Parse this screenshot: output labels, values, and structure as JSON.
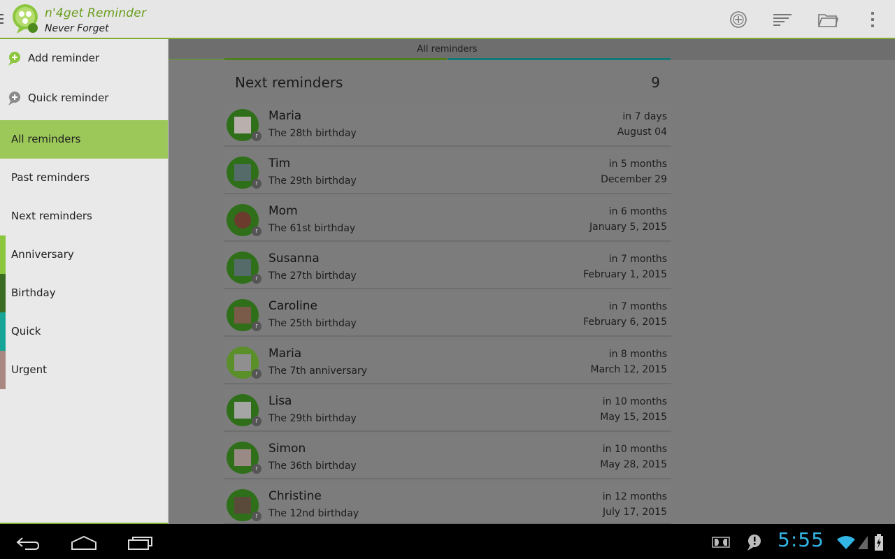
{
  "app": {
    "title": "n'4get Reminder",
    "subtitle": "Never Forget",
    "accent": "#7fae2e"
  },
  "actions": {
    "add_icon": "circle-plus-icon",
    "sort_icon": "sort-lines-icon",
    "folder_icon": "folder-icon",
    "overflow_icon": "overflow-dots-icon"
  },
  "drawer": {
    "actions": [
      {
        "label": "Add reminder",
        "icon": "add-bubble-icon"
      },
      {
        "label": "Quick reminder",
        "icon": "quick-bubble-icon"
      }
    ],
    "filters": [
      {
        "label": "All reminders",
        "selected": true
      },
      {
        "label": "Past reminders",
        "selected": false
      },
      {
        "label": "Next reminders",
        "selected": false
      }
    ],
    "categories": [
      {
        "label": "Anniversary",
        "color": "#8cc63f"
      },
      {
        "label": "Birthday",
        "color": "#3a6d22"
      },
      {
        "label": "Quick",
        "color": "#16a597"
      },
      {
        "label": "Urgent",
        "color": "#a88880"
      }
    ]
  },
  "tabs": {
    "active": "All reminders"
  },
  "list": {
    "title": "Next reminders",
    "count": "9",
    "items": [
      {
        "name": "Maria",
        "occasion": "The 28th birthday",
        "when": "in 7 days",
        "date": "August 04",
        "badge": "r"
      },
      {
        "name": "Tim",
        "occasion": "The 29th birthday",
        "when": "in 5 months",
        "date": "December 29",
        "badge": "r"
      },
      {
        "name": "Mom",
        "occasion": "The 61st birthday",
        "when": "in 6 months",
        "date": "January 5, 2015",
        "badge": "r"
      },
      {
        "name": "Susanna",
        "occasion": "The 27th birthday",
        "when": "in 7 months",
        "date": "February 1, 2015",
        "badge": "r"
      },
      {
        "name": "Caroline",
        "occasion": "The 25th birthday",
        "when": "in 7 months",
        "date": "February 6, 2015",
        "badge": "r"
      },
      {
        "name": "Maria",
        "occasion": "The 7th anniversary",
        "when": "in 8 months",
        "date": "March 12, 2015",
        "badge": "r"
      },
      {
        "name": "Lisa",
        "occasion": "The 29th birthday",
        "when": "in 10 months",
        "date": "May 15, 2015",
        "badge": "r"
      },
      {
        "name": "Simon",
        "occasion": "The 36th birthday",
        "when": "in 10 months",
        "date": "May 28, 2015",
        "badge": "r"
      },
      {
        "name": "Christine",
        "occasion": "The 12nd birthday",
        "when": "in 12 months",
        "date": "July 17, 2015",
        "badge": "r"
      }
    ]
  },
  "system": {
    "time": "5:55",
    "back_icon": "back-icon",
    "home_icon": "home-icon",
    "recents_icon": "recent-apps-icon",
    "dolby_icon": "dolby-icon",
    "notify_icon": "notification-bubble-icon",
    "wifi_icon": "wifi-icon",
    "signal_icon": "signal-icon",
    "battery_icon": "battery-charging-icon"
  }
}
